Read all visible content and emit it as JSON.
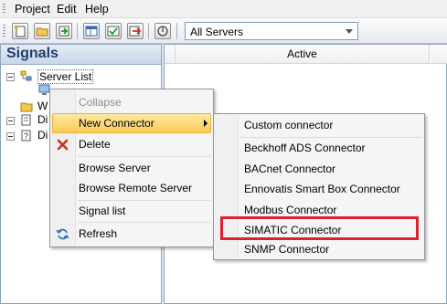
{
  "menubar": {
    "items": [
      "Project",
      "Edit",
      "Help"
    ]
  },
  "toolbar": {
    "server_filter": {
      "value": "All Servers"
    }
  },
  "signals_panel": {
    "title": "Signals",
    "tree": [
      {
        "label": "Server List"
      },
      {
        "label": "W"
      },
      {
        "label": "Di"
      },
      {
        "label": "Di"
      }
    ]
  },
  "grid": {
    "columns": [
      "Active"
    ]
  },
  "context_menu": {
    "items": [
      {
        "label": "Collapse",
        "enabled": false
      },
      {
        "label": "New Connector",
        "submenu": true,
        "highlighted": true
      },
      {
        "label": "Delete",
        "icon": "red-x-icon"
      },
      {
        "label": "Browse Server"
      },
      {
        "label": "Browse Remote Server"
      },
      {
        "label": "Signal list"
      },
      {
        "label": "Refresh",
        "icon": "refresh-icon"
      }
    ]
  },
  "connector_submenu": {
    "items": [
      {
        "label": "Custom connector"
      },
      {
        "label": "Beckhoff ADS Connector"
      },
      {
        "label": "BACnet Connector"
      },
      {
        "label": "Ennovatis Smart Box Connector"
      },
      {
        "label": "Modbus Connector"
      },
      {
        "label": "SIMATIC Connector",
        "annotated": true
      },
      {
        "label": "SNMP Connector"
      }
    ]
  },
  "colors": {
    "menu_highlight": "#fbcc55",
    "annotation_box": "#d9232e",
    "panel_title": "#1f3d6b"
  }
}
